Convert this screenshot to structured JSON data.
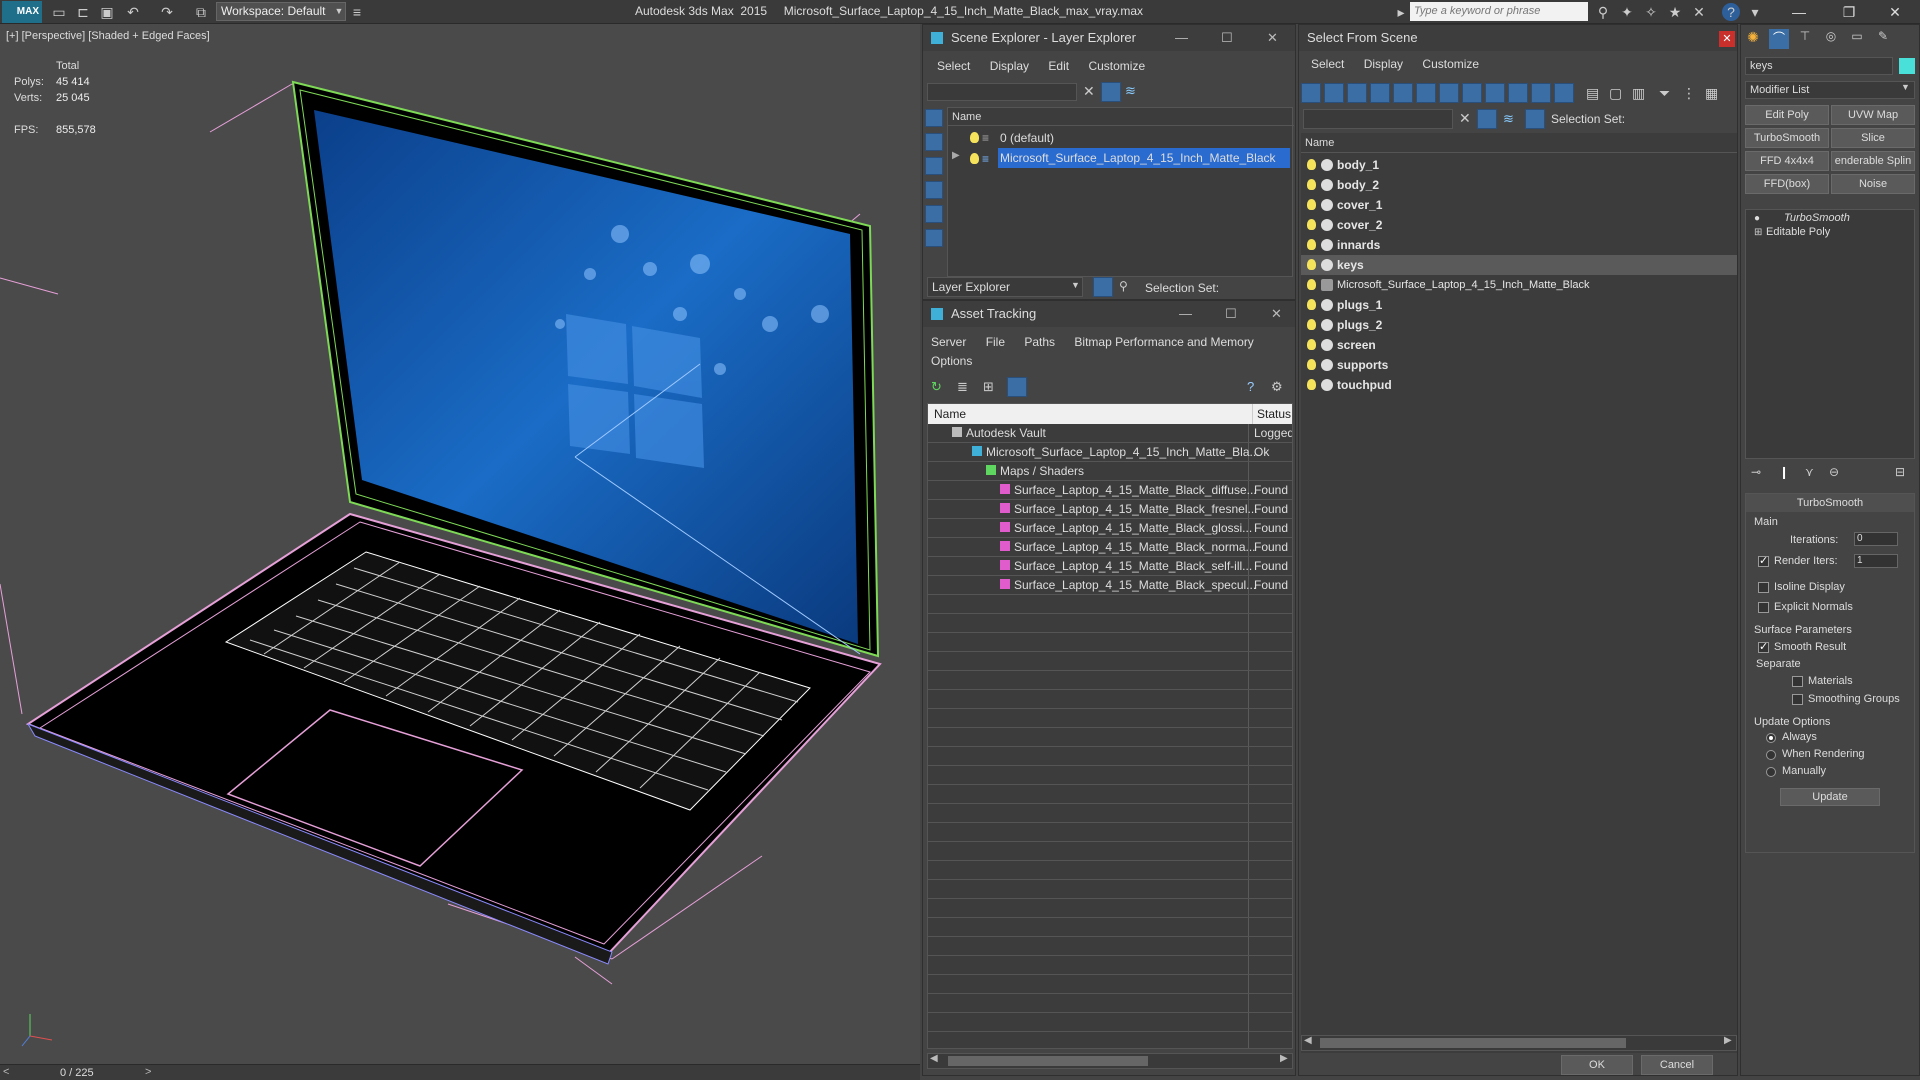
{
  "titlebar": {
    "logo": "MAX",
    "workspace": "Workspace: Default",
    "app_title": "Autodesk 3ds Max  2015     Microsoft_Surface_Laptop_4_15_Inch_Matte_Black_max_vray.max",
    "search_placeholder": "Type a keyword or phrase"
  },
  "viewport": {
    "label": "[+] [Perspective] [Shaded + Edged Faces]",
    "stats": {
      "total_label": "Total",
      "polys_label": "Polys:",
      "polys": "45 414",
      "verts_label": "Verts:",
      "verts": "25 045",
      "fps_label": "FPS:",
      "fps": "855,578"
    }
  },
  "timeslider": {
    "frame": "0 / 225",
    "left": "<",
    "right": ">"
  },
  "scene_explorer": {
    "title": "Scene Explorer - Layer Explorer",
    "menu": [
      "Select",
      "Display",
      "Edit",
      "Customize"
    ],
    "column_name": "Name",
    "layers": [
      "0 (default)",
      "Microsoft_Surface_Laptop_4_15_Inch_Matte_Black"
    ],
    "footer_dropdown": "Layer Explorer",
    "selection_set": "Selection Set:"
  },
  "asset_tracking": {
    "title": "Asset Tracking",
    "menu": [
      "Server",
      "File",
      "Paths",
      "Bitmap Performance and Memory",
      "Options"
    ],
    "columns": {
      "name": "Name",
      "status": "Status"
    },
    "rows": [
      {
        "name": "Autodesk Vault",
        "status": "Logged"
      },
      {
        "name": "Microsoft_Surface_Laptop_4_15_Inch_Matte_Bla...",
        "status": "Ok"
      },
      {
        "name": "Maps / Shaders",
        "status": ""
      },
      {
        "name": "Surface_Laptop_4_15_Matte_Black_diffuse...",
        "status": "Found"
      },
      {
        "name": "Surface_Laptop_4_15_Matte_Black_fresnel...",
        "status": "Found"
      },
      {
        "name": "Surface_Laptop_4_15_Matte_Black_glossi...",
        "status": "Found"
      },
      {
        "name": "Surface_Laptop_4_15_Matte_Black_norma...",
        "status": "Found"
      },
      {
        "name": "Surface_Laptop_4_15_Matte_Black_self-ill...",
        "status": "Found"
      },
      {
        "name": "Surface_Laptop_4_15_Matte_Black_specul...",
        "status": "Found"
      }
    ]
  },
  "select_from_scene": {
    "title": "Select From Scene",
    "menu": [
      "Select",
      "Display",
      "Customize"
    ],
    "selection_set": "Selection Set:",
    "column_name": "Name",
    "items": [
      "body_1",
      "body_2",
      "cover_1",
      "cover_2",
      "innards",
      "keys",
      "Microsoft_Surface_Laptop_4_15_Inch_Matte_Black",
      "plugs_1",
      "plugs_2",
      "screen",
      "supports",
      "touchpud"
    ],
    "ok": "OK",
    "cancel": "Cancel"
  },
  "command_panel": {
    "object_name": "keys",
    "modifier_list": "Modifier List",
    "buttons": [
      "Edit Poly",
      "UVW Map",
      "TurboSmooth",
      "Slice",
      "FFD 4x4x4",
      "enderable Splin",
      "FFD(box)",
      "Noise"
    ],
    "stack": [
      "TurboSmooth",
      "Editable Poly"
    ],
    "rollout_title": "TurboSmooth",
    "main": "Main",
    "iterations_label": "Iterations:",
    "iterations": "0",
    "render_iters_label": "Render Iters:",
    "render_iters": "1",
    "isoline": "Isoline Display",
    "explicit_normals": "Explicit Normals",
    "surface_params": "Surface Parameters",
    "smooth_result": "Smooth Result",
    "separate": "Separate",
    "materials": "Materials",
    "smoothing_groups": "Smoothing Groups",
    "update_options": "Update Options",
    "always": "Always",
    "when_rendering": "When Rendering",
    "manually": "Manually",
    "update": "Update"
  }
}
